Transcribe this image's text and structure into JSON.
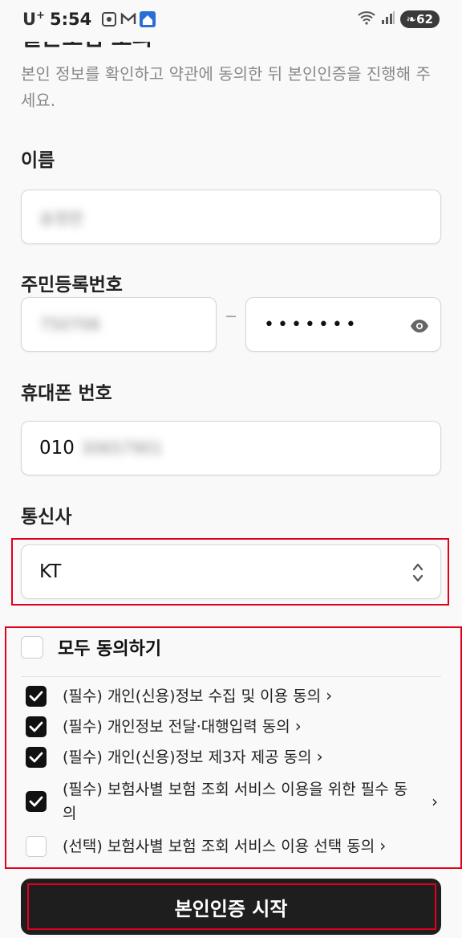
{
  "status_bar": {
    "carrier": "U",
    "carrier_sup": "+",
    "time": "5:54",
    "battery": "62"
  },
  "header": {
    "title": "실손보험 조회",
    "description": "본인 정보를 확인하고 약관에 동의한 뒤 본인인증을 진행해 주세요."
  },
  "form": {
    "name": {
      "label": "이름",
      "value": "송정란"
    },
    "rrn": {
      "label": "주민등록번호",
      "front": "750706",
      "back_masked": "•••••••"
    },
    "phone": {
      "label": "휴대폰 번호",
      "prefix": "010",
      "rest": "30657901"
    },
    "carrier": {
      "label": "통신사",
      "selected": "KT"
    }
  },
  "agreements": {
    "all_label": "모두 동의하기",
    "items": [
      {
        "label": "(필수) 개인(신용)정보 수집 및 이용 동의"
      },
      {
        "label": "(필수) 개인정보 전달·대행입력 동의"
      },
      {
        "label": "(필수) 개인(신용)정보 제3자 제공 동의"
      },
      {
        "label": "(필수) 보험사별 보험 조회 서비스 이용을 위한 필수 동의"
      },
      {
        "label": "(선택) 보험사별 보험 조회 서비스 이용 선택 동의"
      }
    ]
  },
  "actions": {
    "start_label": "본인인증 시작"
  },
  "colors": {
    "accent": "#111111",
    "highlight": "#e3001b"
  }
}
